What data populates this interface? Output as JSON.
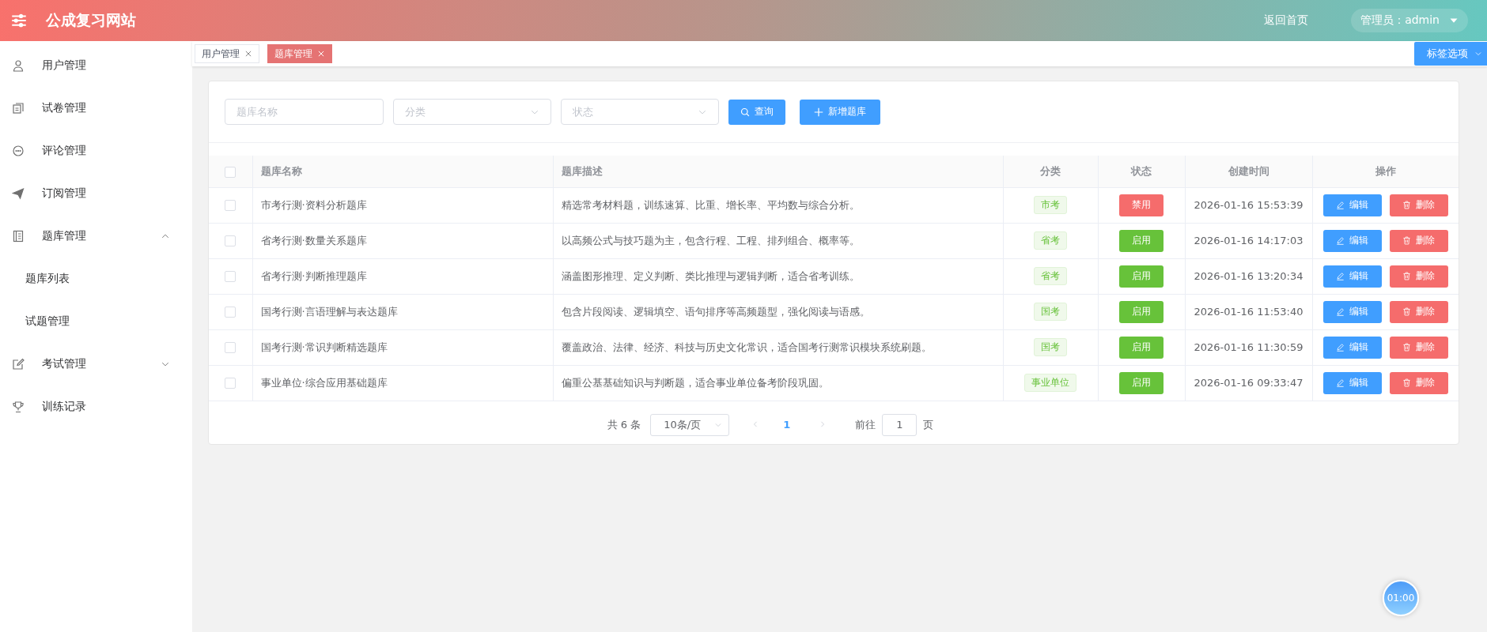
{
  "header": {
    "site_title": "公成复习网站",
    "home_link": "返回首页",
    "user_menu": "管理员：admin"
  },
  "sidebar": {
    "items": [
      {
        "label": "用户管理"
      },
      {
        "label": "试卷管理"
      },
      {
        "label": "评论管理"
      },
      {
        "label": "订阅管理"
      },
      {
        "label": "题库管理",
        "expanded": true,
        "children": [
          {
            "label": "题库列表"
          },
          {
            "label": "试题管理"
          }
        ]
      },
      {
        "label": "考试管理",
        "expanded": false
      },
      {
        "label": "训练记录"
      }
    ]
  },
  "tabs": [
    {
      "label": "用户管理",
      "selected": false
    },
    {
      "label": "题库管理",
      "selected": true
    }
  ],
  "tab_options": "标签选项",
  "filters": {
    "name": {
      "placeholder": "题库名称"
    },
    "category": {
      "placeholder": "分类"
    },
    "status": {
      "placeholder": "状态"
    },
    "search_button": "查询",
    "add_button": "新增题库"
  },
  "table": {
    "all_checked": false,
    "columns": [
      "题库名称",
      "题库描述",
      "分类",
      "状态",
      "创建时间",
      "操作"
    ],
    "rows": [
      {
        "checked": false,
        "name": "市考行测·资料分析题库",
        "description": "精选常考材料题，训练速算、比重、增长率、平均数与综合分析。",
        "category": "市考",
        "status": {
          "label": "禁用",
          "kind": "disabled"
        },
        "created": "2026-01-16 15:53:39",
        "edit": "编辑",
        "delete": "删除"
      },
      {
        "checked": false,
        "name": "省考行测·数量关系题库",
        "description": "以高频公式与技巧题为主，包含行程、工程、排列组合、概率等。",
        "category": "省考",
        "status": {
          "label": "启用",
          "kind": "enabled"
        },
        "created": "2026-01-16 14:17:03",
        "edit": "编辑",
        "delete": "删除"
      },
      {
        "checked": false,
        "name": "省考行测·判断推理题库",
        "description": "涵盖图形推理、定义判断、类比推理与逻辑判断，适合省考训练。",
        "category": "省考",
        "status": {
          "label": "启用",
          "kind": "enabled"
        },
        "created": "2026-01-16 13:20:34",
        "edit": "编辑",
        "delete": "删除"
      },
      {
        "checked": false,
        "name": "国考行测·言语理解与表达题库",
        "description": "包含片段阅读、逻辑填空、语句排序等高频题型，强化阅读与语感。",
        "category": "国考",
        "status": {
          "label": "启用",
          "kind": "enabled"
        },
        "created": "2026-01-16 11:53:40",
        "edit": "编辑",
        "delete": "删除"
      },
      {
        "checked": false,
        "name": "国考行测·常识判断精选题库",
        "description": "覆盖政治、法律、经济、科技与历史文化常识，适合国考行测常识模块系统刷题。",
        "category": "国考",
        "status": {
          "label": "启用",
          "kind": "enabled"
        },
        "created": "2026-01-16 11:30:59",
        "edit": "编辑",
        "delete": "删除"
      },
      {
        "checked": false,
        "name": "事业单位·综合应用基础题库",
        "description": "偏重公基基础知识与判断题，适合事业单位备考阶段巩固。",
        "category": "事业单位",
        "status": {
          "label": "启用",
          "kind": "enabled"
        },
        "created": "2026-01-16 09:33:47",
        "edit": "编辑",
        "delete": "删除"
      }
    ]
  },
  "pagination": {
    "total": "共 6 条",
    "page_size": "10条/页",
    "pages": [
      {
        "label": "1",
        "selected": true
      }
    ],
    "goto_label": "前往",
    "goto_value": "1",
    "goto_suffix": "页"
  },
  "timer": "01:00"
}
